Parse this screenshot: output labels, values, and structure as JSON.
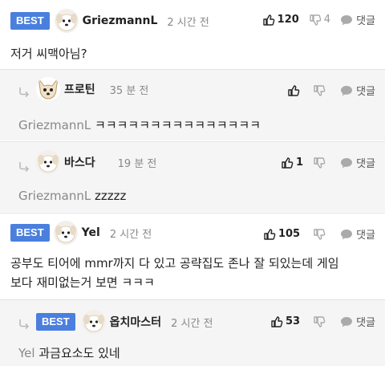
{
  "comments": [
    {
      "best_label": "BEST",
      "user": "GriezmannL",
      "time": "2 시간 전",
      "likes": "120",
      "dislikes": "4",
      "reply_label": "댓글",
      "body": "저거 씨맥아님?"
    },
    {
      "user": "프로틴",
      "time": "35 분 전",
      "likes": "",
      "dislikes": "",
      "reply_label": "댓글",
      "mention": "GriezmannL",
      "body": "ㅋㅋㅋㅋㅋㅋㅋㅋㅋㅋㅋㅋㅋㅋㅋ"
    },
    {
      "user": "바스다",
      "time": "19 분 전",
      "likes": "1",
      "dislikes": "",
      "reply_label": "댓글",
      "mention": "GriezmannL",
      "body": "zzzzz"
    },
    {
      "best_label": "BEST",
      "user": "Yel",
      "time": "2 시간 전",
      "likes": "105",
      "dislikes": "",
      "reply_label": "댓글",
      "body_line1": "공부도 티어에 mmr까지 다 있고 공략집도 존나 잘 되있는데 게임",
      "body_line2": "보다 재미없는거 보면 ㅋㅋㅋ"
    },
    {
      "best_label": "BEST",
      "user": "옵치마스터",
      "time": "2 시간 전",
      "likes": "53",
      "dislikes": "",
      "reply_label": "댓글",
      "mention": "Yel",
      "body": "과금요소도 있네"
    }
  ],
  "colors": {
    "best_badge": "#4a7fde",
    "reply_bg": "#f5f5f5"
  },
  "icons": [
    "thumbs-up-icon",
    "thumbs-down-icon",
    "speech-bubble-icon",
    "reply-arrow-icon",
    "avatar-dog"
  ]
}
